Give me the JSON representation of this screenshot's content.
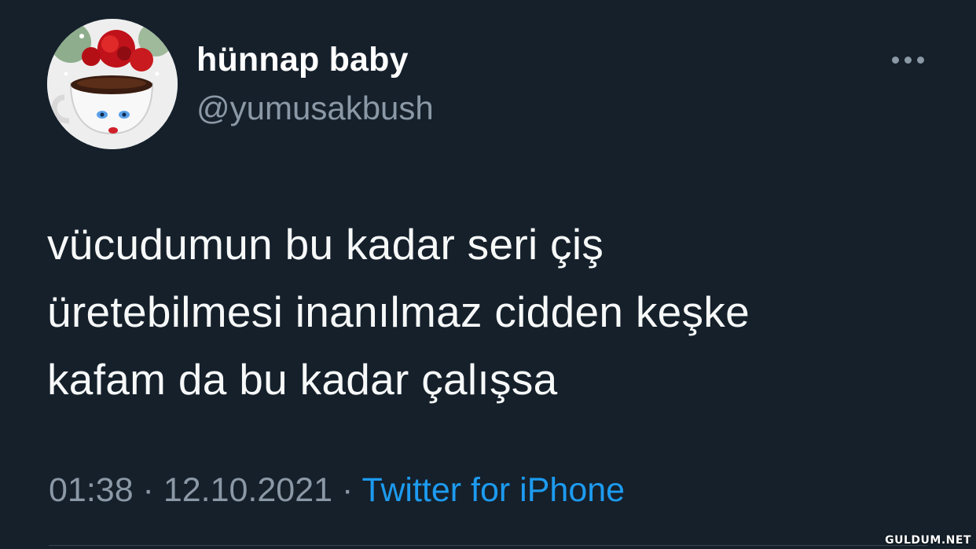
{
  "tweet": {
    "author": {
      "display_name": "hünnap baby",
      "handle": "@yumusakbush",
      "avatar_icon": "coffee-cup-roses-avatar"
    },
    "more_icon": "more-horizontal-icon",
    "text_lines": [
      "vücudumun bu kadar seri çiş",
      "üretebilmesi inanılmaz cidden keşke",
      "kafam da bu kadar çalışsa"
    ],
    "time": "01:38",
    "separator": " · ",
    "date": "12.10.2021",
    "source": "Twitter for iPhone"
  },
  "watermark": "GULDUM.NET",
  "colors": {
    "background": "#15202b",
    "text": "#f7f9f9",
    "muted": "#8b98a5",
    "link": "#1d9bf0"
  }
}
